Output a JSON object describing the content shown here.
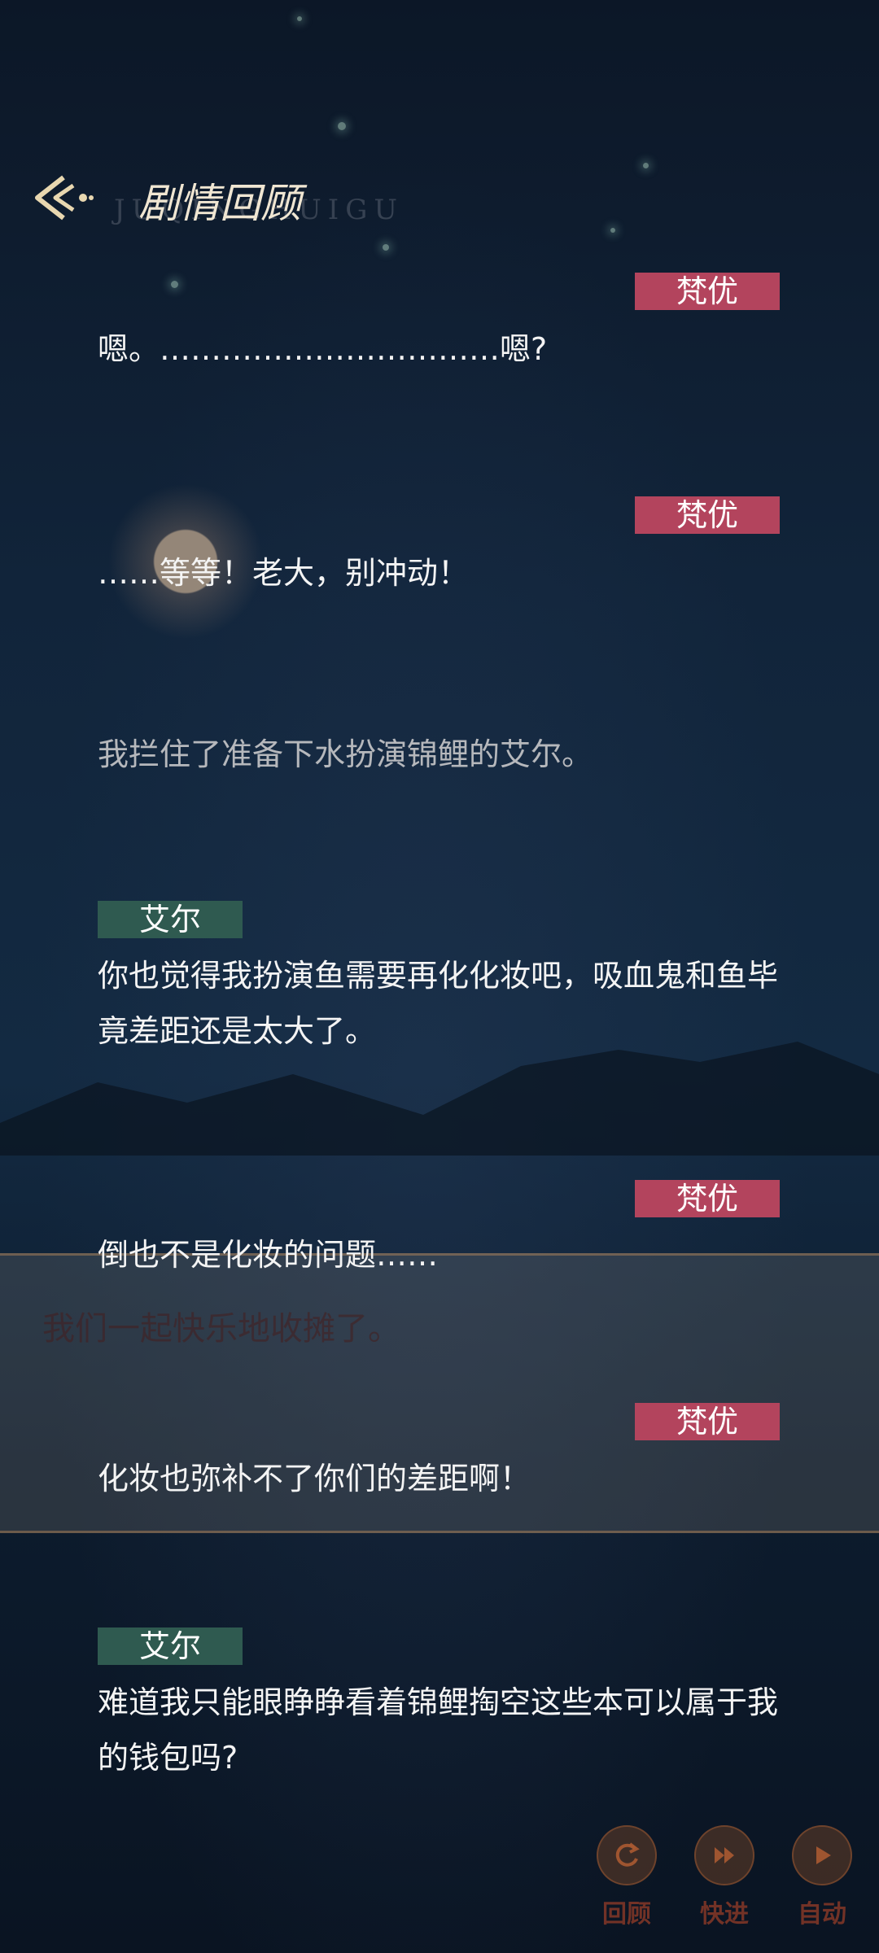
{
  "header": {
    "title": "剧情回顾",
    "title_pinyin": "JUQINGHUIGU"
  },
  "background_text": "我们一起快乐地收摊了。",
  "dialogue": [
    {
      "speaker": "梵优",
      "text": "嗯。……………………………嗯?"
    },
    {
      "speaker": "梵优",
      "text": "……等等！老大，别冲动！"
    },
    {
      "speaker": "",
      "text": "我拦住了准备下水扮演锦鲤的艾尔。"
    },
    {
      "speaker": "艾尔",
      "text": "你也觉得我扮演鱼需要再化化妆吧，吸血鬼和鱼毕竟差距还是太大了。"
    },
    {
      "speaker": "梵优",
      "text": "倒也不是化妆的问题……"
    },
    {
      "speaker": "梵优",
      "text": "化妆也弥补不了你们的差距啊！"
    },
    {
      "speaker": "艾尔",
      "text": "难道我只能眼睁睁看着锦鲤掏空这些本可以属于我的钱包吗?"
    }
  ],
  "controls": {
    "review": "回顾",
    "fast_forward": "快进",
    "auto": "自动"
  },
  "colors": {
    "speaker_fanyou": "#b3445d",
    "speaker_aier": "#2f5a50"
  }
}
